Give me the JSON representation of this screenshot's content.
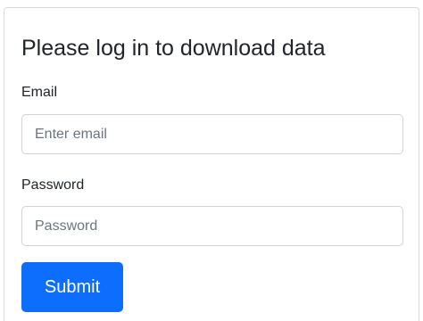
{
  "form": {
    "title": "Please log in to download data",
    "email": {
      "label": "Email",
      "value": "",
      "placeholder": "Enter email"
    },
    "password": {
      "label": "Password",
      "value": "",
      "placeholder": "Password"
    },
    "submit_label": "Submit"
  },
  "colors": {
    "primary": "#0d6efd",
    "text": "#212529",
    "input_border": "#ced4da",
    "placeholder": "#6c757d"
  }
}
